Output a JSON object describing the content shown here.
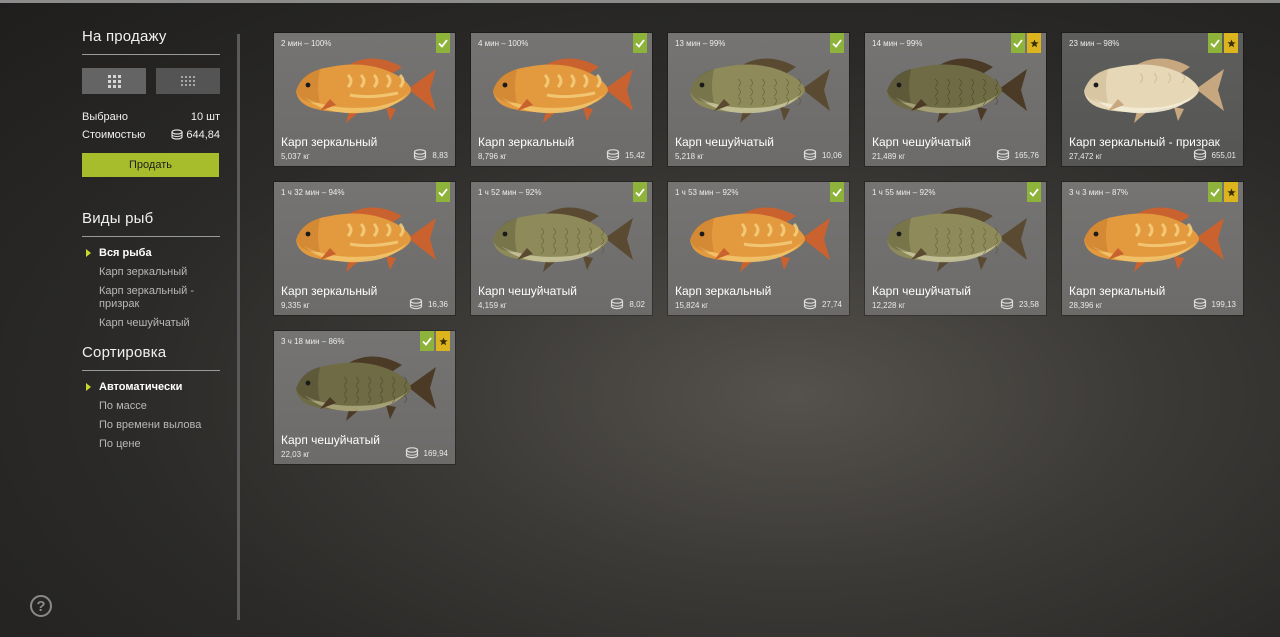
{
  "sidebar": {
    "sale_title": "На продажу",
    "view_buttons": [
      {
        "icon": "large-grid-icon",
        "active": true
      },
      {
        "icon": "small-grid-icon",
        "active": false
      }
    ],
    "selected_label": "Выбрано",
    "selected_value": "10 шт",
    "cost_label": "Стоимостью",
    "cost_value": "644,84",
    "sell_button": "Продать",
    "species_title": "Виды рыб",
    "species": [
      "Вся рыба",
      "Карп зеркальный",
      "Карп зеркальный - призрак",
      "Карп чешуйчатый"
    ],
    "species_active": 0,
    "sort_title": "Сортировка",
    "sort": [
      "Автоматически",
      "По массе",
      "По времени вылова",
      "По цене"
    ],
    "sort_active": 0,
    "help_label": "?"
  },
  "colors": {
    "accent": "#a8bd2c",
    "check": "#8db33a",
    "star": "#dcb51e"
  },
  "cards": [
    {
      "time": "2 мин – 100%",
      "name": "Карп зеркальный",
      "weight": "5,037 кг",
      "price": "8,83",
      "fish": "mirror",
      "star": false,
      "selected": false
    },
    {
      "time": "4 мин – 100%",
      "name": "Карп зеркальный",
      "weight": "8,796 кг",
      "price": "15,42",
      "fish": "mirror",
      "star": false,
      "selected": false
    },
    {
      "time": "13 мин – 99%",
      "name": "Карп чешуйчатый",
      "weight": "5,218 кг",
      "price": "10,06",
      "fish": "common",
      "star": false,
      "selected": false
    },
    {
      "time": "14 мин – 99%",
      "name": "Карп чешуйчатый",
      "weight": "21,489 кг",
      "price": "165,76",
      "fish": "common-dark",
      "star": true,
      "selected": false
    },
    {
      "time": "23 мин – 98%",
      "name": "Карп зеркальный - призрак",
      "weight": "27,472 кг",
      "price": "655,01",
      "fish": "ghost",
      "star": true,
      "selected": true
    },
    {
      "time": "1 ч 32 мин – 94%",
      "name": "Карп зеркальный",
      "weight": "9,335 кг",
      "price": "16,36",
      "fish": "mirror",
      "star": false,
      "selected": false
    },
    {
      "time": "1 ч 52 мин – 92%",
      "name": "Карп чешуйчатый",
      "weight": "4,159 кг",
      "price": "8,02",
      "fish": "common",
      "star": false,
      "selected": false
    },
    {
      "time": "1 ч 53 мин – 92%",
      "name": "Карп зеркальный",
      "weight": "15,824 кг",
      "price": "27,74",
      "fish": "mirror",
      "star": false,
      "selected": false
    },
    {
      "time": "1 ч 55 мин – 92%",
      "name": "Карп чешуйчатый",
      "weight": "12,228 кг",
      "price": "23,58",
      "fish": "common",
      "star": false,
      "selected": false
    },
    {
      "time": "3 ч 3 мин – 87%",
      "name": "Карп зеркальный",
      "weight": "28,396 кг",
      "price": "199,13",
      "fish": "mirror",
      "star": true,
      "selected": false
    },
    {
      "time": "3 ч 18 мин – 86%",
      "name": "Карп чешуйчатый",
      "weight": "22,03 кг",
      "price": "169,94",
      "fish": "common-dark",
      "star": true,
      "selected": false
    }
  ]
}
